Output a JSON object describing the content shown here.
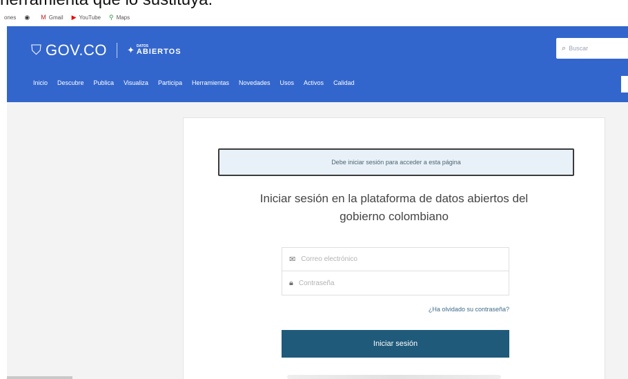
{
  "caption": {
    "text": "herramienta que lo sustituya."
  },
  "bookmarks": [
    {
      "label": "ones",
      "icon": "apps-icon"
    },
    {
      "label": "",
      "icon": "globe-icon"
    },
    {
      "label": "Gmail",
      "icon": "gmail-icon"
    },
    {
      "label": "YouTube",
      "icon": "youtube-icon"
    },
    {
      "label": "Maps",
      "icon": "maps-icon"
    }
  ],
  "header": {
    "gov_logo": "GOV.CO",
    "datos_small": "DATOS",
    "datos_big": "ABIERTOS",
    "search_placeholder": "Buscar",
    "nav": [
      "Inicio",
      "Descubre",
      "Publica",
      "Visualiza",
      "Participa",
      "Herramientas",
      "Novedades",
      "Usos",
      "Activos",
      "Calidad"
    ]
  },
  "login": {
    "alert": "Debe iniciar sesión para acceder a esta página",
    "title_line1": "Iniciar sesión en la plataforma de datos abiertos del",
    "title_line2": "gobierno colombiano",
    "email_placeholder": "Correo electrónico",
    "password_placeholder": "Contraseña",
    "forgot": "¿Ha olvidado su contraseña?",
    "submit": "Iniciar sesión"
  },
  "colors": {
    "header_blue": "#3366cc",
    "button_blue": "#1f5a7a",
    "alert_bg": "#e8f1f7"
  }
}
